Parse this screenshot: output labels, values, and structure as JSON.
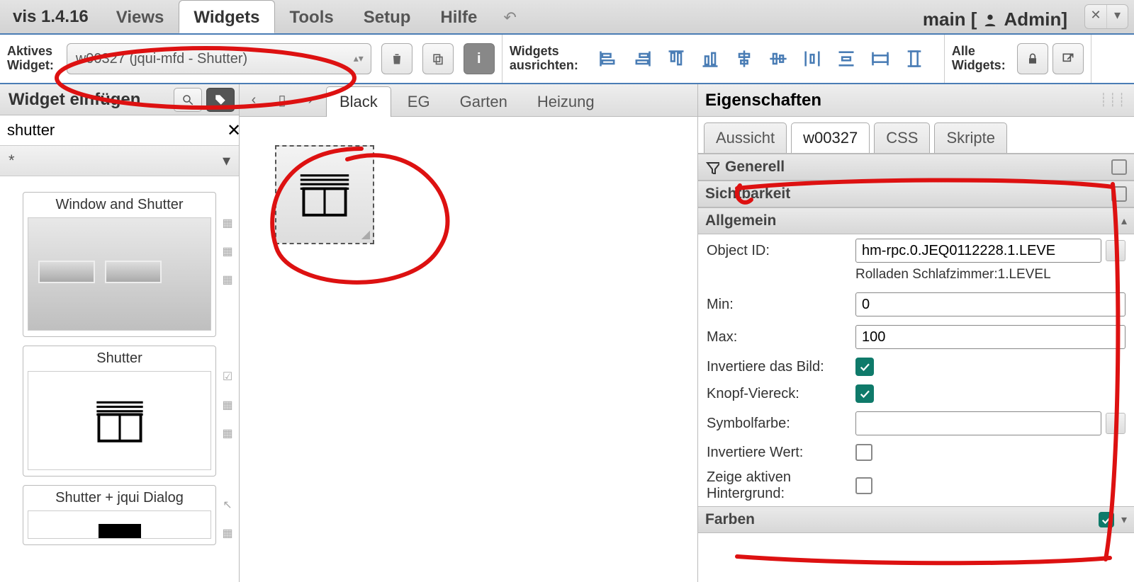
{
  "app_title": "vis 1.4.16",
  "menu": {
    "views": "Views",
    "widgets": "Widgets",
    "tools": "Tools",
    "setup": "Setup",
    "help": "Hilfe"
  },
  "context": {
    "view": "main [",
    "role": "Admin]",
    "full": "main [  Admin]"
  },
  "toolbar": {
    "active_widget_label": "Aktives\nWidget:",
    "active_widget_value": "w00327 (jqui-mfd - Shutter)",
    "align_label": "Widgets\nausrichten:",
    "all_widgets_label": "Alle\nWidgets:"
  },
  "leftpane": {
    "title": "Widget einfügen",
    "search_value": "shutter",
    "filter_value": "*",
    "cards": [
      {
        "title": "Window and Shutter"
      },
      {
        "title": "Shutter"
      },
      {
        "title": "Shutter + jqui Dialog"
      }
    ]
  },
  "center": {
    "tabs": [
      "Black",
      "EG",
      "Garten",
      "Heizung"
    ],
    "active_tab_visible_fragment": ""
  },
  "rightpane": {
    "title": "Eigenschaften",
    "tabs": {
      "view": "Aussicht",
      "widget": "w00327",
      "css": "CSS",
      "scripts": "Skripte"
    },
    "sections": {
      "general": "Generell",
      "visibility": "Sichtbarkeit",
      "common": "Allgemein",
      "colors": "Farben"
    },
    "props": {
      "object_id_label": "Object ID:",
      "object_id_value": "hm-rpc.0.JEQ0112228.1.LEVE",
      "object_id_sub": "Rolladen Schlafzimmer:1.LEVEL",
      "min_label": "Min:",
      "min_value": "0",
      "max_label": "Max:",
      "max_value": "100",
      "invert_img_label": "Invertiere das Bild:",
      "invert_img_value": true,
      "knopf_label": "Knopf-Viereck:",
      "knopf_value": true,
      "symbol_color_label": "Symbolfarbe:",
      "symbol_color_value": "",
      "invert_val_label": "Invertiere Wert:",
      "invert_val_value": false,
      "active_bg_label": "Zeige aktiven\nHintergrund:",
      "active_bg_value": false
    }
  }
}
